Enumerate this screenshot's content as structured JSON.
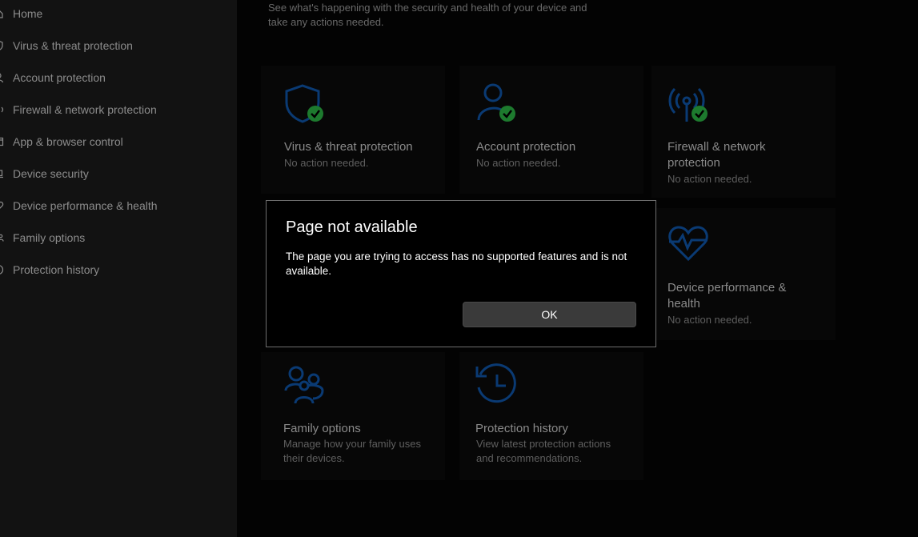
{
  "sidebar": {
    "items": [
      {
        "label": "Home",
        "icon": "home-icon"
      },
      {
        "label": "Virus & threat protection",
        "icon": "shield-icon"
      },
      {
        "label": "Account protection",
        "icon": "person-icon"
      },
      {
        "label": "Firewall & network protection",
        "icon": "wifi-icon"
      },
      {
        "label": "App & browser control",
        "icon": "app-browser-icon"
      },
      {
        "label": "Device security",
        "icon": "laptop-icon"
      },
      {
        "label": "Device performance & health",
        "icon": "heart-icon"
      },
      {
        "label": "Family options",
        "icon": "family-icon"
      },
      {
        "label": "Protection history",
        "icon": "history-icon"
      }
    ]
  },
  "main": {
    "subtitle": "See what's happening with the security and health of your device and take any actions needed.",
    "tiles": {
      "virus": {
        "title": "Virus & threat protection",
        "desc": "No action needed.",
        "icon": "shield-check-icon"
      },
      "account": {
        "title": "Account protection",
        "desc": "No action needed.",
        "icon": "person-check-icon"
      },
      "firewall": {
        "title": "Firewall & network protection",
        "desc": "No action needed.",
        "icon": "antenna-check-icon"
      },
      "performance": {
        "title": "Device performance & health",
        "desc": "No action needed.",
        "icon": "heart-pulse-icon"
      },
      "family": {
        "title": "Family options",
        "desc": "Manage how your family uses their devices.",
        "icon": "family-icon"
      },
      "history": {
        "title": "Protection history",
        "desc": "View latest protection actions and recommendations.",
        "icon": "clock-history-icon"
      }
    }
  },
  "dialog": {
    "title": "Page not available",
    "message": "The page you are trying to access has no supported features and is not available.",
    "ok_label": "OK"
  },
  "colors": {
    "accent": "#0a3a73",
    "check_green": "#1d7a2e",
    "sidebar_bg": "#121212",
    "main_bg": "#030303"
  }
}
